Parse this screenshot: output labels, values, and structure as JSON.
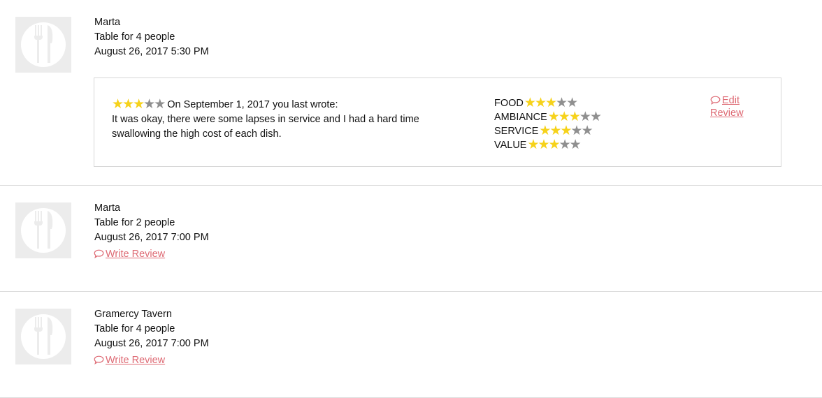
{
  "colors": {
    "accent_link": "#de6a74",
    "star_filled": "#f6d21a",
    "star_empty": "#8f8f8f",
    "thumbnail_bg": "#ececec",
    "divider": "#dcdcdc"
  },
  "icons": {
    "thumbnail": "fork-knife-icon",
    "star": "star-icon",
    "comment": "speech-bubble-icon"
  },
  "reservations": [
    {
      "restaurant": "Marta",
      "party": "Table for 4 people",
      "datetime": "August 26, 2017 5:30 PM",
      "review": {
        "overall_stars": 3,
        "max_stars": 5,
        "header": "On September 1, 2017 you last wrote:",
        "text": "It was okay, there were some lapses in service and I had a hard time swallowing the high cost of each dish.",
        "ratings": [
          {
            "label": "FOOD",
            "stars": 3
          },
          {
            "label": "AMBIANCE",
            "stars": 3
          },
          {
            "label": "SERVICE",
            "stars": 3
          },
          {
            "label": "VALUE",
            "stars": 3
          }
        ],
        "edit_label": "Edit Review"
      }
    },
    {
      "restaurant": "Marta",
      "party": "Table for 2 people",
      "datetime": "August 26, 2017 7:00 PM",
      "write_label": "Write Review"
    },
    {
      "restaurant": "Gramercy Tavern",
      "party": "Table for 4 people",
      "datetime": "August 26, 2017 7:00 PM",
      "write_label": "Write Review"
    }
  ]
}
